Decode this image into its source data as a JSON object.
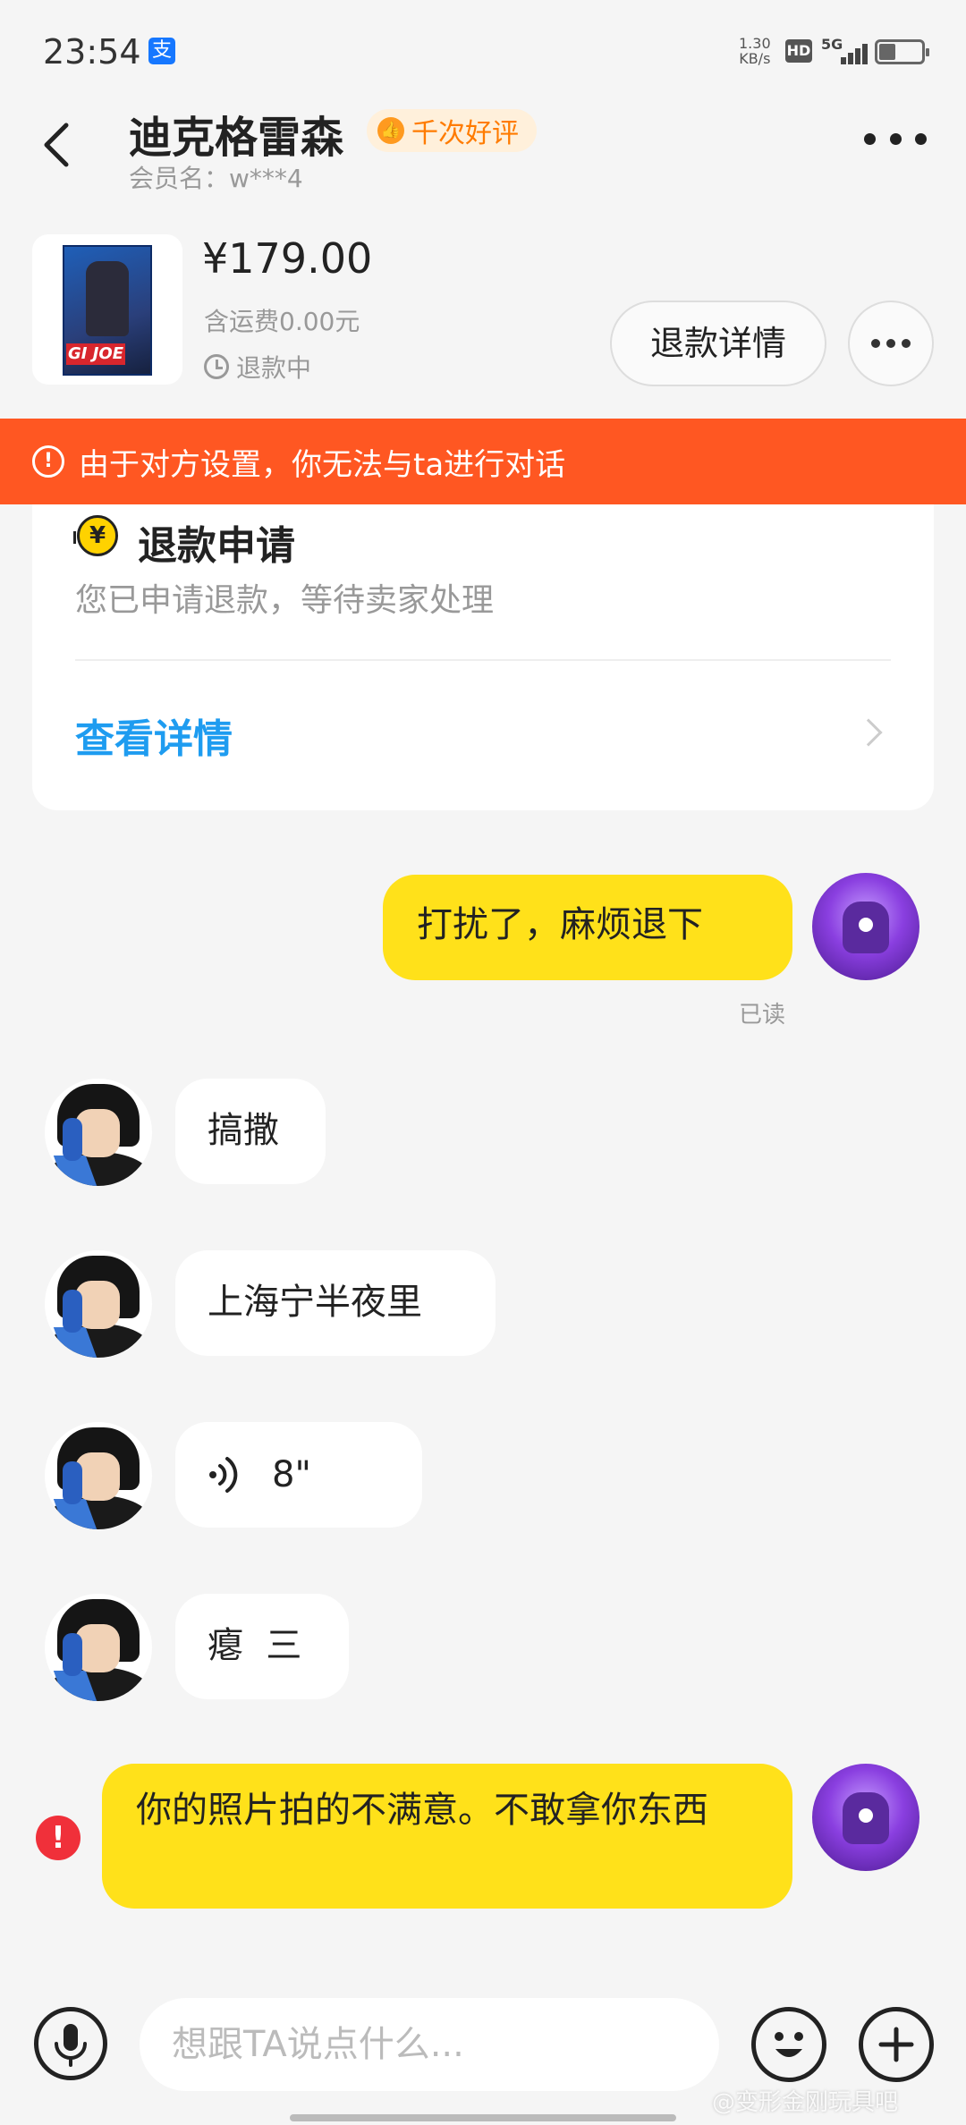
{
  "status_bar": {
    "time": "23:54",
    "net_speed_value": "1.30",
    "net_speed_unit": "KB/s",
    "hd_label": "HD",
    "network": "5G",
    "app_icon": "alipay-icon"
  },
  "header": {
    "seller_name": "迪克格雷森",
    "rating_badge": "千次好评",
    "member_label": "会员名：w***4"
  },
  "product": {
    "price": "¥179.00",
    "shipping": "含运费0.00元",
    "status": "退款中",
    "thumb_logo": "GI JOE",
    "refund_detail_button": "退款详情"
  },
  "warning": {
    "text": "由于对方设置，你无法与ta进行对话"
  },
  "refund_card": {
    "title": "退款申请",
    "description": "您已申请退款，等待卖家处理",
    "link": "查看详情"
  },
  "messages": [
    {
      "sender": "me",
      "type": "text",
      "text": "打扰了，麻烦退下",
      "read_label": "已读"
    },
    {
      "sender": "seller",
      "type": "text",
      "text": "搞撒"
    },
    {
      "sender": "seller",
      "type": "text",
      "text": "上海宁半夜里"
    },
    {
      "sender": "seller",
      "type": "voice",
      "text": "8\""
    },
    {
      "sender": "seller",
      "type": "text",
      "text": "瘪  三"
    },
    {
      "sender": "me",
      "type": "text",
      "text": "你的照片拍的不满意。不敢拿你东西",
      "failed": true
    }
  ],
  "input_bar": {
    "placeholder": "想跟TA说点什么..."
  },
  "watermark": "@变形金刚玩具吧",
  "colors": {
    "accent_yellow": "#ffe11a",
    "warning_orange": "#ff5722",
    "link_blue": "#1e9cf0",
    "error_red": "#f0303a"
  }
}
